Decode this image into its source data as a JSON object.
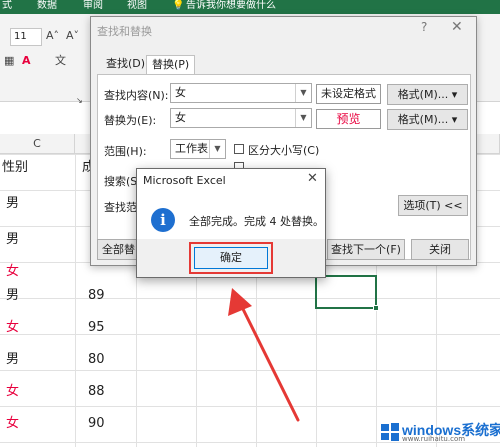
{
  "ribbon": {
    "tabs": [
      "式",
      "数据",
      "审阅",
      "视图"
    ],
    "tell_me": "告诉我你想要做什么",
    "font_size": "11"
  },
  "sheet": {
    "column_c": "C",
    "header_gender": "性别",
    "header_score_partial": "成",
    "rows": [
      {
        "gender": "男",
        "score": ""
      },
      {
        "gender": "男",
        "score": ""
      },
      {
        "gender": "女",
        "score": ""
      },
      {
        "gender": "男",
        "score": "89"
      },
      {
        "gender": "女",
        "score": "95"
      },
      {
        "gender": "男",
        "score": "80"
      },
      {
        "gender": "女",
        "score": "88"
      },
      {
        "gender": "女",
        "score": "90"
      }
    ]
  },
  "find_replace": {
    "title": "查找和替换",
    "help": "?",
    "close": "✕",
    "tab_find": "查找(D)",
    "tab_replace": "替换(P)",
    "find_label": "查找内容(N):",
    "find_value": "女",
    "replace_label": "替换为(E):",
    "replace_value": "女",
    "no_format": "未设定格式",
    "preview": "预览",
    "format_button": "格式(M)...",
    "scope_label": "范围(H):",
    "scope_value": "工作表",
    "match_case": "区分大小写(C)",
    "search_label": "搜索(S",
    "lookin_label": "查找范",
    "options_button": "选项(T) <<",
    "replace_all_partial": "全部替",
    "find_next": "查找下一个(F)",
    "close_button": "关闭"
  },
  "message_box": {
    "title": "Microsoft Excel",
    "close": "✕",
    "message": "全部完成。完成 4 处替换。",
    "ok": "确定"
  },
  "watermark": {
    "name": "windows系统家园",
    "url": "www.ruihaitu.com"
  },
  "colors": {
    "excel_green": "#217346",
    "female_text": "#e8003d",
    "annotation": "#e53935",
    "info_blue": "#1e6fd0"
  }
}
